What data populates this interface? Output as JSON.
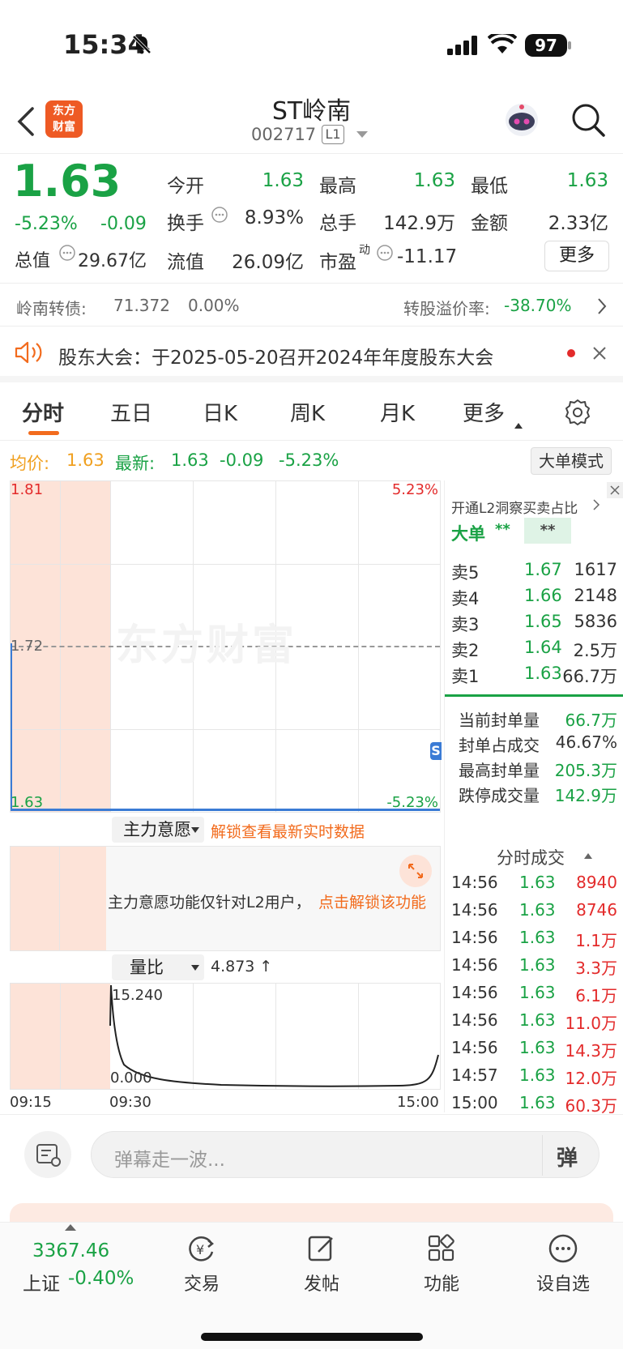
{
  "status_bar": {
    "time": "15:34",
    "battery": "97"
  },
  "header": {
    "logo_text_1": "东方",
    "logo_text_2": "财富",
    "stock_name": "ST岭南",
    "stock_code": "002717",
    "level_badge": "L1"
  },
  "quote": {
    "price": "1.63",
    "change_pct": "-5.23%",
    "change": "-0.09",
    "open_label": "今开",
    "open_value": "1.63",
    "high_label": "最高",
    "high_value": "1.63",
    "low_label": "最低",
    "low_value": "1.63",
    "turnover_label": "换手",
    "turnover_value": "8.93%",
    "volume_label": "总手",
    "volume_value": "142.9万",
    "amount_label": "金额",
    "amount_value": "2.33亿",
    "mktcap_label": "总值",
    "mktcap_value": "29.67亿",
    "float_label": "流值",
    "float_value": "26.09亿",
    "pe_label": "市盈",
    "pe_superscript": "动",
    "pe_value": "-11.17",
    "more_button": "更多"
  },
  "bond": {
    "label": "岭南转债:",
    "price": "71.372",
    "change": "0.00%",
    "premium_label": "转股溢价率:",
    "premium_value": "-38.70%"
  },
  "notice": {
    "text": "股东大会：于2025-05-20召开2024年年度股东大会"
  },
  "tabs": [
    "分时",
    "五日",
    "日K",
    "周K",
    "月K",
    "更多"
  ],
  "chart_info": {
    "avg_label": "均价:",
    "avg_value": "1.63",
    "latest_label": "最新:",
    "latest_value": "1.63",
    "latest_change": "-0.09",
    "latest_pct": "-5.23%",
    "big_order_button": "大单模式"
  },
  "chart": {
    "y_top": "1.81",
    "y_mid": "1.72",
    "y_bottom": "1.63",
    "pct_top": "5.23%",
    "pct_bottom": "-5.23%",
    "watermark": "东方财富",
    "s_badge": "S"
  },
  "main_force": {
    "selector": "主力意愿",
    "unlock_link": "解锁查看最新实时数据",
    "msg_text": "主力意愿功能仅针对L2用户，",
    "msg_link": "点击解锁该功能"
  },
  "volume_ratio": {
    "selector": "量比",
    "value": "4.873 ↑",
    "top": "15.240",
    "bottom": "0.000",
    "times": [
      "09:15",
      "09:30",
      "15:00"
    ]
  },
  "orderbook": {
    "l2_link": "开通L2洞察买卖占比",
    "big_label": "大单",
    "big_v1": "**",
    "big_v2": "**",
    "rows": [
      {
        "label": "卖5",
        "price": "1.67",
        "vol": "1617"
      },
      {
        "label": "卖4",
        "price": "1.66",
        "vol": "2148"
      },
      {
        "label": "卖3",
        "price": "1.65",
        "vol": "5836"
      },
      {
        "label": "卖2",
        "price": "1.64",
        "vol": "2.5万"
      },
      {
        "label": "卖1",
        "price": "1.63",
        "vol": "66.7万"
      }
    ],
    "seal": [
      {
        "label": "当前封单量",
        "value": "66.7万"
      },
      {
        "label": "封单占成交",
        "value": "46.67%"
      },
      {
        "label": "最高封单量",
        "value": "205.3万"
      },
      {
        "label": "跌停成交量",
        "value": "142.9万"
      }
    ]
  },
  "transactions": {
    "title": "分时成交",
    "rows": [
      {
        "time": "14:56",
        "price": "1.63",
        "vol": "8940"
      },
      {
        "time": "14:56",
        "price": "1.63",
        "vol": "8746"
      },
      {
        "time": "14:56",
        "price": "1.63",
        "vol": "1.1万"
      },
      {
        "time": "14:56",
        "price": "1.63",
        "vol": "3.3万"
      },
      {
        "time": "14:56",
        "price": "1.63",
        "vol": "6.1万"
      },
      {
        "time": "14:56",
        "price": "1.63",
        "vol": "11.0万"
      },
      {
        "time": "14:56",
        "price": "1.63",
        "vol": "14.3万"
      },
      {
        "time": "14:57",
        "price": "1.63",
        "vol": "12.0万"
      },
      {
        "time": "15:00",
        "price": "1.63",
        "vol": "60.3万"
      }
    ]
  },
  "comment": {
    "placeholder": "弹幕走一波...",
    "danmaku_icon": "弹"
  },
  "bottom_nav": {
    "index_value": "3367.46",
    "index_name": "上证",
    "index_change": "-0.40%",
    "items": [
      "交易",
      "发帖",
      "功能",
      "设自选"
    ]
  }
}
